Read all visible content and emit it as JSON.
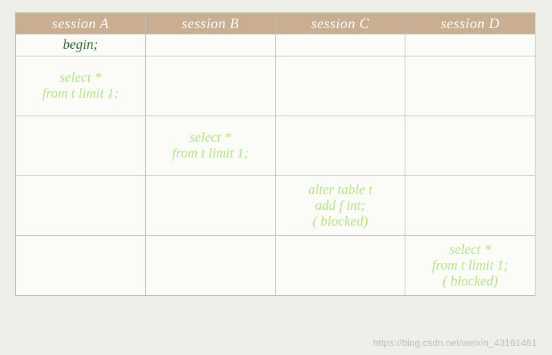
{
  "headers": {
    "a": "session A",
    "b": "session B",
    "c": "session C",
    "d": "session D"
  },
  "cells": {
    "r1a": "begin;",
    "r2a": "select *\nfrom t limit 1;",
    "r3b": "select *\nfrom t limit 1;",
    "r4c": "alter table t\nadd f int;\n( blocked)",
    "r5d": "select *\nfrom t limit 1;\n( blocked)"
  },
  "watermark": "https://blog.csdn.net/weixin_43161461"
}
